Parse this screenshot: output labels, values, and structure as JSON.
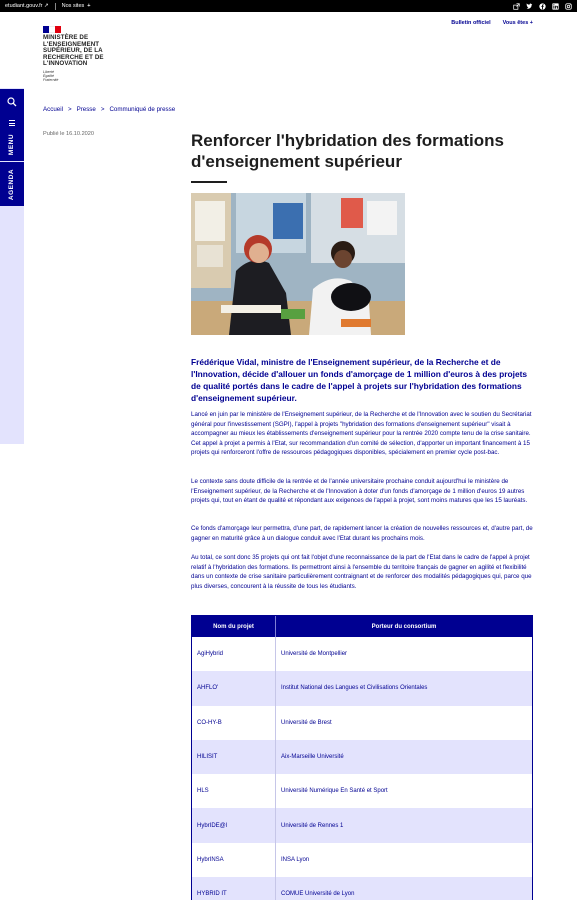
{
  "topbar": {
    "site_link": "etudiant.gouv.fr ↗",
    "sites_label": "Nos sites",
    "plus": "+",
    "social_icons": [
      "external-link-icon",
      "twitter-icon",
      "facebook-icon",
      "linkedin-icon",
      "instagram-icon"
    ]
  },
  "logo": {
    "ministry": "MINISTÈRE DE L'ENSEIGNEMENT SUPÉRIEUR, DE LA RECHERCHE ET DE L'INNOVATION",
    "motto_1": "Liberté",
    "motto_2": "Égalité",
    "motto_3": "Fraternité"
  },
  "header_links": {
    "bulletin": "Bulletin officiel",
    "vous_etes": "Vous êtes  +"
  },
  "sidebar": {
    "search_icon": "search-icon",
    "menu_label": "MENU",
    "agenda_label": "AGENDA"
  },
  "breadcrumb": {
    "home": "Accueil",
    "press": "Presse",
    "current": "Communiqué de presse",
    "separator": ">"
  },
  "article": {
    "published": "Publié le 16.10.2020",
    "title": "Renforcer l'hybridation des formations d'enseignement supérieur",
    "chapo": "Frédérique Vidal, ministre de l'Enseignement supérieur, de la Recherche et de l'Innovation, décide d'allouer un fonds d'amorçage de 1 million d'euros à des projets de qualité portés dans le cadre de l'appel à projets sur l'hybridation des formations d'enseignement supérieur.",
    "p1": "Lancé en juin par le ministère de l'Enseignement supérieur, de la Recherche et de l'Innovation avec le soutien du Secrétariat général pour l'investissement (SGPI), l'appel à projets \"hybridation des formations d'enseignement supérieur\" visait à accompagner au mieux les établissements d'enseignement supérieur pour la rentrée 2020 compte tenu de la crise sanitaire. Cet appel à projet a permis à l'Etat, sur recommandation d'un comité de sélection, d'apporter un important financement à 15 projets qui renforceront l'offre de ressources pédagogiques disponibles, spécialement en premier cycle post-bac.",
    "p2": "Le contexte sans doute difficile de la rentrée et de l'année universitaire prochaine conduit aujourd'hui le ministère de l'Enseignement supérieur, de la Recherche et de l'Innovation à doter d'un fonds d'amorçage de 1 million d'euros 19 autres projets qui, tout en étant de qualité et répondant aux exigences de l'appel à projet, sont moins matures que les 15 lauréats.",
    "p3": "Ce fonds d'amorçage leur permettra, d'une part, de rapidement lancer la création de nouvelles ressources et, d'autre part, de gagner en maturité grâce à un dialogue conduit avec l'Etat durant les prochains mois.",
    "p4": "Au total, ce sont donc 35 projets qui ont fait l'objet d'une reconnaissance de la part de l'Etat dans le cadre de l'appel à projet relatif à l'hybridation des formations. Ils permettront ainsi à l'ensemble du territoire français de gagner en agilité et flexibilité dans un contexte de crise sanitaire particulièrement contraignant et de renforcer des modalités pédagogiques qui, parce que plus diverses, concourent à la réussite de tous les étudiants."
  },
  "table": {
    "headers": [
      "Nom du projet",
      "Porteur du consortium"
    ],
    "rows": [
      [
        "AgiHybrid",
        "Université de Montpellier"
      ],
      [
        "AHFLO'",
        "Institut National des Langues et Civilisations Orientales"
      ],
      [
        "CO-HY-B",
        "Université de Brest"
      ],
      [
        "HILISIT",
        "Aix-Marseille Université"
      ],
      [
        "HLS",
        "Université Numérique En Santé et Sport"
      ],
      [
        "HybrIDE@l",
        "Université de Rennes 1"
      ],
      [
        "HybrINSA",
        "INSA Lyon"
      ],
      [
        "HYBRID IT",
        "COMUE Université de Lyon"
      ]
    ]
  },
  "colors": {
    "brand_blue": "#000091",
    "light_blue": "#e3e3fd",
    "flag_red": "#e1000f"
  }
}
